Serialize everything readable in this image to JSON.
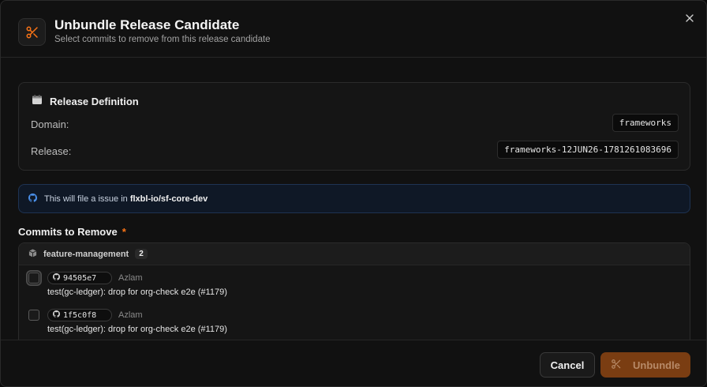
{
  "dialog": {
    "title": "Unbundle Release Candidate",
    "subtitle": "Select commits to remove from this release candidate"
  },
  "release_definition": {
    "title": "Release Definition",
    "domain_label": "Domain:",
    "domain_value": "frameworks",
    "release_label": "Release:",
    "release_value": "frameworks-12JUN26-1781261083696"
  },
  "info_banner": {
    "prefix": "This will file a issue in",
    "repo": "flxbl-io/sf-core-dev"
  },
  "commits_section": {
    "label": "Commits to Remove",
    "required_marker": "*",
    "group": {
      "name": "feature-management",
      "count": "2"
    },
    "commits": [
      {
        "sha": "94505e7",
        "author": "Azlam",
        "message": "test(gc-ledger): drop for org-check e2e (#1179)"
      },
      {
        "sha": "1f5c0f8",
        "author": "Azlam",
        "message": "test(gc-ledger): drop for org-check e2e (#1179)"
      }
    ]
  },
  "footer": {
    "cancel_label": "Cancel",
    "unbundle_label": "Unbundle"
  },
  "colors": {
    "accent": "#f97316",
    "info_border": "#1e3352",
    "unbundle_bg": "#7a3d12"
  },
  "icons": {
    "header": "scissors-icon",
    "close": "close-icon",
    "card": "calendar-icon",
    "info": "github-icon",
    "group": "package-icon",
    "sha": "github-icon",
    "unbundle": "scissors-icon"
  }
}
